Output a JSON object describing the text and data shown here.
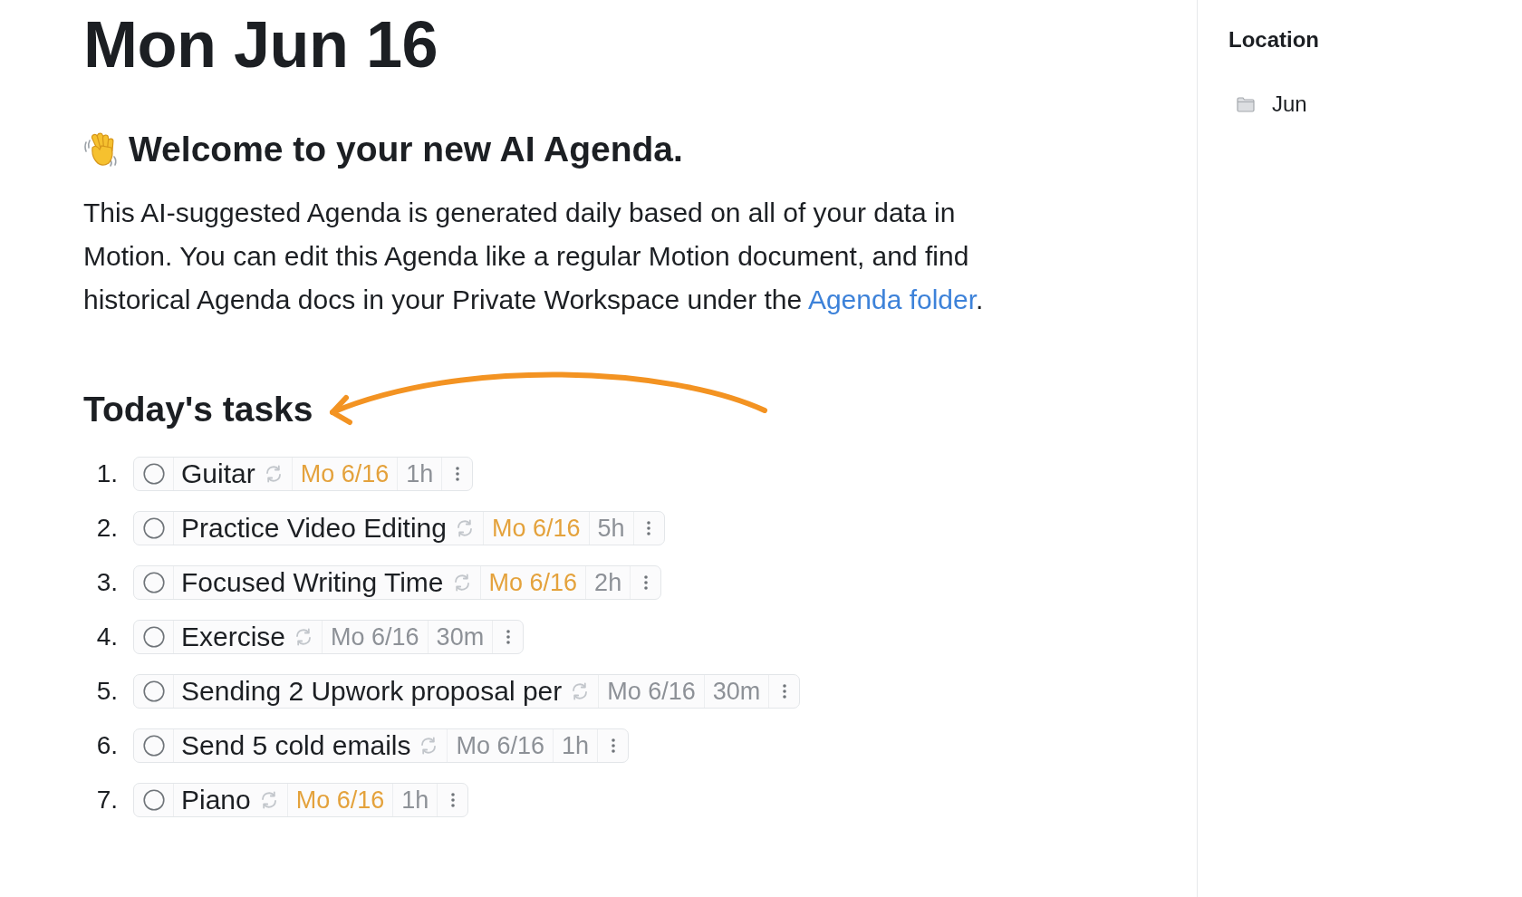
{
  "page_title": "Mon Jun 16",
  "welcome": {
    "heading": "Welcome to your new AI Agenda.",
    "text_before": "This AI-suggested Agenda is generated daily based on all of your data in Motion. You can edit this Agenda like a regular Motion document, and find historical Agenda docs in your Private Workspace under the",
    "link": "Agenda folder",
    "text_after": "."
  },
  "tasks_section": {
    "heading": "Today's tasks",
    "tasks": [
      {
        "number": "1.",
        "checked": false,
        "title": "Guitar",
        "recurring": true,
        "date": "Mo 6/16",
        "color": "#e4a23c",
        "duration": "1h"
      },
      {
        "number": "2.",
        "checked": false,
        "title": "Practice Video Editing",
        "recurring": true,
        "date": "Mo 6/16",
        "color": "#e4a23c",
        "duration": "5h"
      },
      {
        "number": "3.",
        "checked": false,
        "title": "Focused Writing Time",
        "recurring": true,
        "date": "Mo 6/16",
        "color": "#e4a23c",
        "duration": "2h"
      },
      {
        "number": "4.",
        "checked": false,
        "title": "Exercise",
        "recurring": true,
        "date": "Mo 6/16",
        "color": "#8d9197",
        "duration": "30m"
      },
      {
        "number": "5.",
        "checked": false,
        "title": "Sending 2 Upwork proposal per",
        "recurring": true,
        "date": "Mo 6/16",
        "color": "#8d9197",
        "duration": "30m"
      },
      {
        "number": "6.",
        "checked": false,
        "title": "Send 5 cold emails",
        "recurring": true,
        "date": "Mo 6/16",
        "color": "#8d9197",
        "duration": "1h"
      },
      {
        "number": "7.",
        "checked": false,
        "title": "Piano",
        "recurring": true,
        "date": "Mo 6/16",
        "color": "#e4a23c",
        "duration": "1h"
      }
    ]
  },
  "sidebar": {
    "heading": "Location",
    "items": [
      {
        "label": "Jun"
      }
    ]
  }
}
